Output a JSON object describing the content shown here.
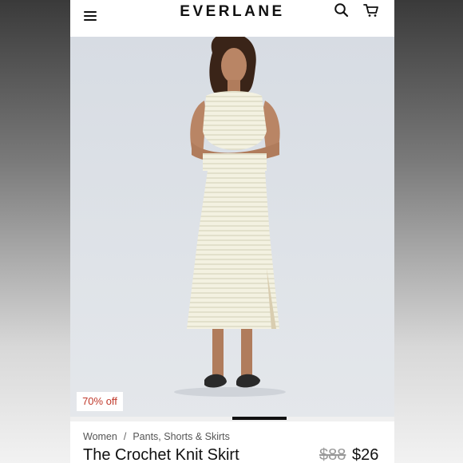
{
  "header": {
    "brand": "EVERLANE",
    "menu_icon": "hamburger-menu-icon",
    "search_icon": "search-icon",
    "cart_icon": "shopping-cart-icon"
  },
  "hero": {
    "image_description_icon": "product-photo",
    "badge": "70% off",
    "gallery_index": 1
  },
  "breadcrumb": {
    "items": [
      "Women",
      "Pants, Shorts & Skirts"
    ],
    "separator": "/"
  },
  "product": {
    "title": "The Crochet Knit Skirt",
    "price_original": "$88",
    "price_sale": "$26"
  },
  "colors": {
    "badge_text": "#c0392b",
    "background": "#dfe3e8",
    "garment": "#f2f0df"
  }
}
